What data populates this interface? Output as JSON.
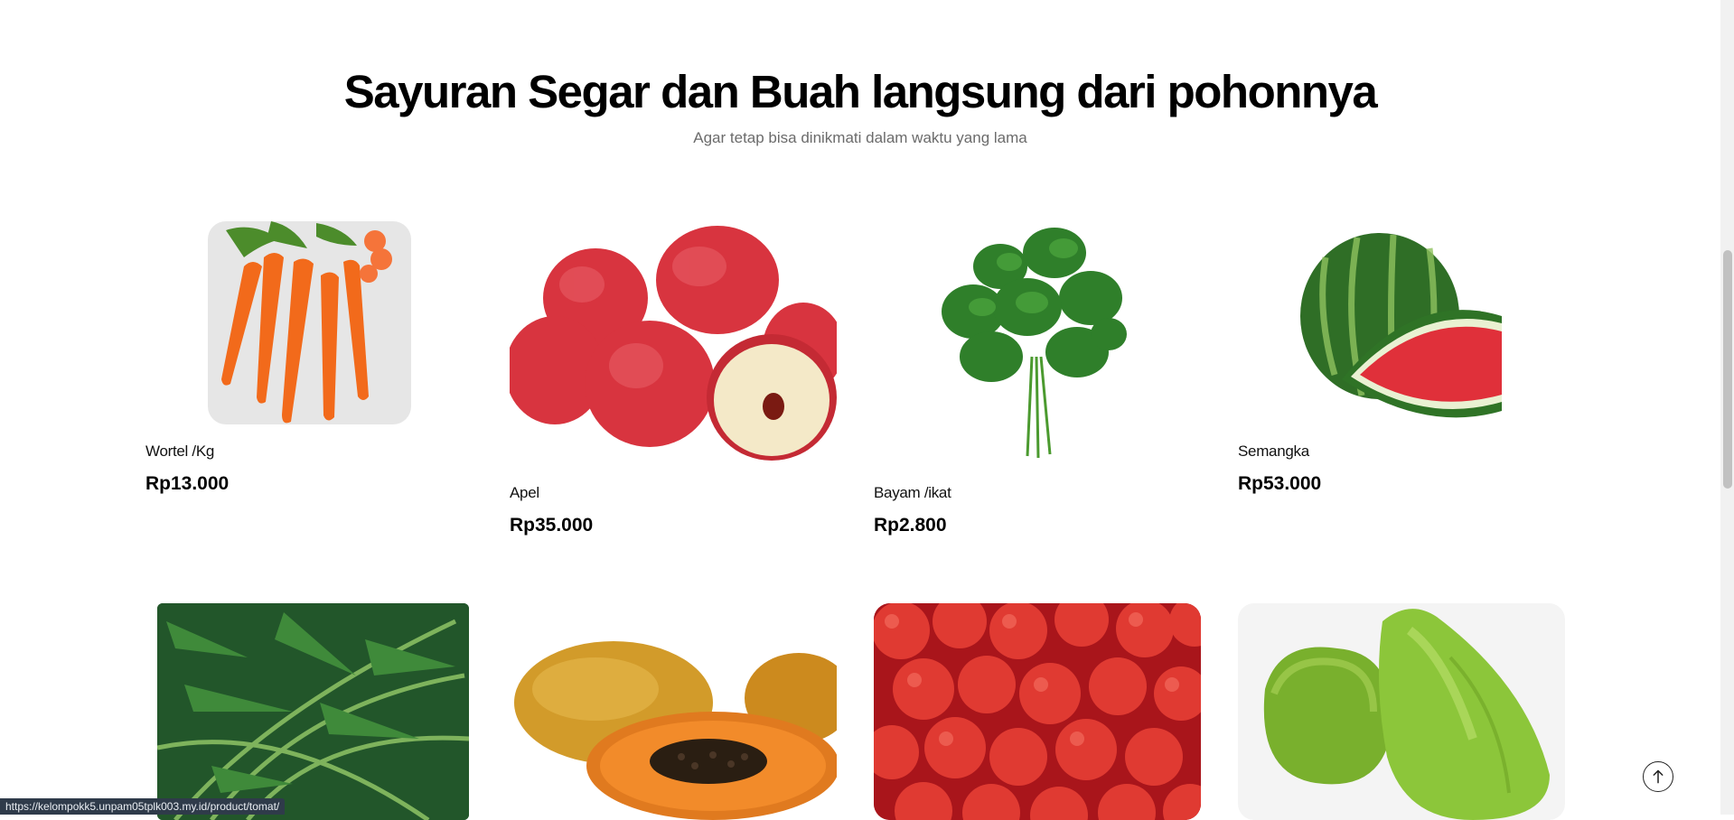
{
  "section": {
    "title": "Sayuran Segar dan Buah langsung dari pohonnya",
    "subtitle": "Agar tetap bisa dinikmati dalam waktu yang lama"
  },
  "products": [
    {
      "name": "Wortel /Kg",
      "price": "Rp13.000",
      "image": "carrot-image"
    },
    {
      "name": "Apel",
      "price": "Rp35.000",
      "image": "apple-image"
    },
    {
      "name": "Bayam /ikat",
      "price": "Rp2.800",
      "image": "spinach-image"
    },
    {
      "name": "Semangka",
      "price": "Rp53.000",
      "image": "watermelon-image"
    },
    {
      "image": "water-spinach-image"
    },
    {
      "image": "papaya-image"
    },
    {
      "image": "tomato-image"
    },
    {
      "image": "chayote-image"
    }
  ],
  "status_bar": {
    "url": "https://kelompokk5.unpam05tplk003.my.id/product/tomat/"
  },
  "back_to_top": {
    "icon": "arrow-up-icon"
  }
}
